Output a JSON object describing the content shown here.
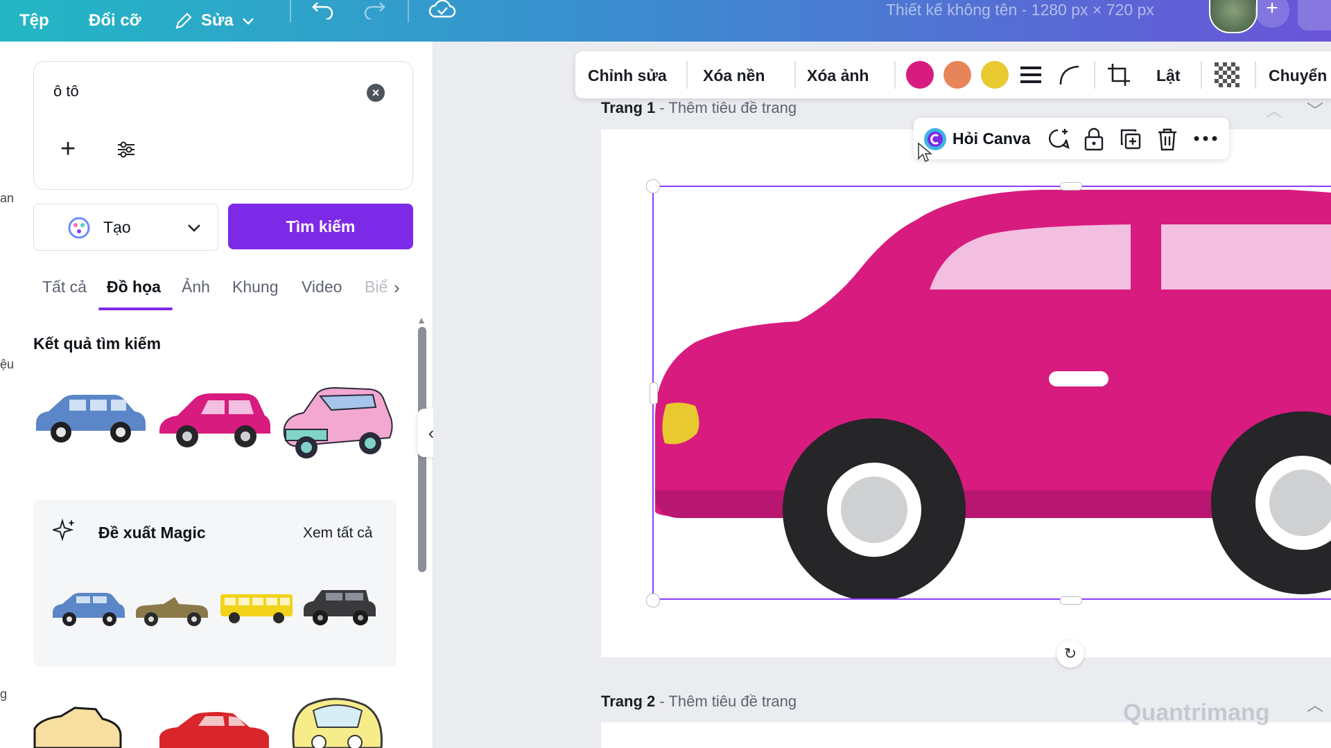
{
  "topbar": {
    "file_label": "Tệp",
    "resize_label": "Đổi cỡ",
    "edit_label": "Sửa",
    "doc_title": "Thiết kế không tên - 1280 px × 720 px",
    "plus": "+"
  },
  "left_strip": {
    "frag1": "an",
    "frag2": "ệu",
    "frag3": "g"
  },
  "search": {
    "value": "ô tô",
    "create_label": "Tạo",
    "search_button": "Tìm kiếm"
  },
  "tabs": [
    "Tất cả",
    "Đồ họa",
    "Ảnh",
    "Khung",
    "Video",
    "Biể"
  ],
  "results": {
    "title": "Kết quả tìm kiếm"
  },
  "magic": {
    "title": "Đề xuất Magic",
    "see_all": "Xem tất cả"
  },
  "context_toolbar": {
    "edit": "Chỉnh sửa",
    "remove_bg": "Xóa nền",
    "erase": "Xóa ảnh",
    "flip": "Lật",
    "animate": "Chuyển",
    "colors": [
      "#d81b7f",
      "#e8845a",
      "#e8c930"
    ]
  },
  "float_bar": {
    "ask": "Hỏi Canva"
  },
  "pages": {
    "page1_name": "Trang 1",
    "page1_hint": "- Thêm tiêu đề trang",
    "page2_name": "Trang 2",
    "page2_hint": "- Thêm tiêu đề trang"
  },
  "car": {
    "body": "#d81b7f",
    "window": "#f3bfe0",
    "wheel": "#262528",
    "hub": "#cfd0d2",
    "light": "#e8c930"
  },
  "watermark": "Quantrimang"
}
